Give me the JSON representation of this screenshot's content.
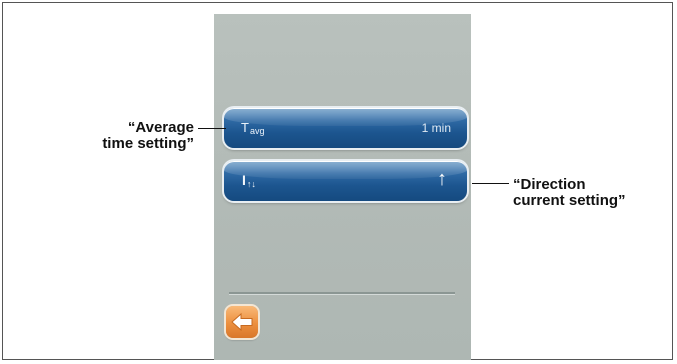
{
  "screen": {
    "average_time": {
      "symbol": "T",
      "symbol_sub": "avg",
      "value": "1 min"
    },
    "direction_current": {
      "symbol": "I",
      "symbol_arrows": "↑↓",
      "value_arrow": "↑"
    },
    "back_icon": "arrow-left-icon"
  },
  "callouts": {
    "average_time_line1": "“Average",
    "average_time_line2": "time setting”",
    "direction_line1": "“Direction",
    "direction_line2": "current setting”"
  },
  "colors": {
    "screen_bg": "#b5bdb9",
    "button_blue": "#1c558f",
    "back_orange": "#ec8f3e"
  }
}
